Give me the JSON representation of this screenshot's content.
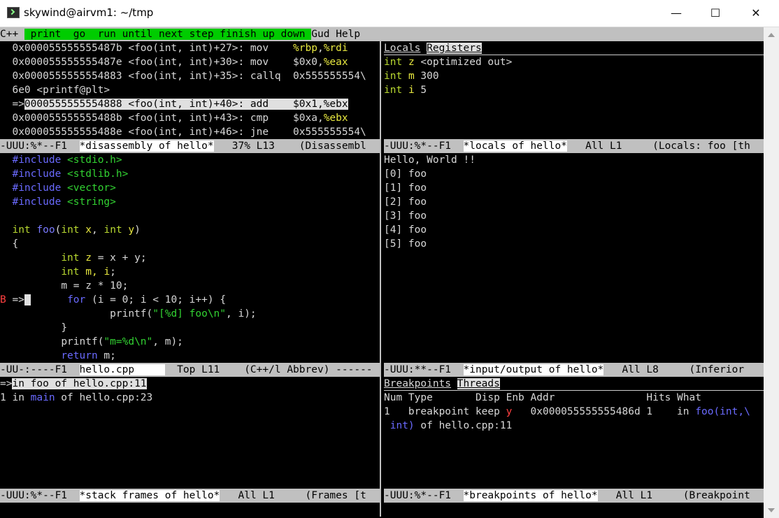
{
  "window": {
    "title": "skywind@airvm1: ~/tmp",
    "min_glyph": "—",
    "max_glyph": "☐",
    "close_glyph": "✕"
  },
  "menubar": {
    "lang": "C++",
    "green_items": " print  go  run until next step finish up down ",
    "gud": "Gud",
    "help": "Help"
  },
  "disasm": {
    "lines": [
      [
        "  0x000055555555487b <foo(int, int)+27>: mov    ",
        "%rbp",
        ",",
        "%rdi"
      ],
      [
        "  0x000055555555487e <foo(int, int)+30>: mov    $0x0,",
        "%eax",
        "",
        ""
      ],
      [
        "  0x0000555555554883 <foo(int, int)+35>: callq  0x555555554\\",
        "",
        "",
        ""
      ],
      [
        "  6e0 <printf@plt>",
        "",
        "",
        ""
      ],
      [
        "  =>",
        "0000555555554888 <foo(int, int)+40>: add    $0x1,%ebx",
        "",
        ""
      ],
      [
        "  0x000055555555488b <foo(int, int)+43>: cmp    $0xa,",
        "%ebx",
        "",
        ""
      ],
      [
        "  0x000055555555488e <foo(int, int)+46>: jne    0x555555554\\",
        "",
        "",
        ""
      ]
    ],
    "modeline_pre": "-UUU:%*--F1  ",
    "modeline_name": "*disassembly of hello*",
    "modeline_post": "   37% L13    (Disassembl"
  },
  "locals": {
    "tab1": "Locals",
    "tab2": "Registers",
    "vars": [
      {
        "type": "int",
        "name": "z",
        "value": "<optimized out>"
      },
      {
        "type": "int",
        "name": "m",
        "value": "300"
      },
      {
        "type": "int",
        "name": "i",
        "value": "5"
      }
    ],
    "modeline_pre": "-UUU:%*--F1  ",
    "modeline_name": "*locals of hello*",
    "modeline_post": "   All L1     (Locals: foo [th"
  },
  "source": {
    "includes": [
      [
        "#include",
        "<stdio.h>"
      ],
      [
        "#include",
        "<stdlib.h>"
      ],
      [
        "#include",
        "<vector>"
      ],
      [
        "#include",
        "<string>"
      ]
    ],
    "sig_int": "int",
    "sig_fn": "foo",
    "sig_p1t": "int",
    "sig_p1": "x",
    "sig_p2t": "int",
    "sig_p2": "y",
    "open": "{",
    "l_z_t": "int",
    "l_z": "z",
    "l_z_rest": " = x + y;",
    "l_m_t": "int",
    "l_m": "m, i",
    "l_m_rest": ";",
    "l_assign": "m = z * 10;",
    "bp_mark": "B",
    "arrow": " =>",
    "l_for_kw": "for",
    "l_for_rest": " (i = 0; i < 10; i++) {",
    "l_printf1_a": "printf(",
    "l_printf1_s": "\"[%d] foo\\n\"",
    "l_printf1_b": ", i);",
    "close_inner": "}",
    "l_printf2_a": "printf(",
    "l_printf2_s": "\"m=%d\\n\"",
    "l_printf2_b": ", m);",
    "l_return_kw": "return",
    "l_return_rest": " m;",
    "modeline_pre": "-UU-:----F1  ",
    "modeline_name": "hello.cpp     ",
    "modeline_post": "  Top L11    (C++/l Abbrev) ------"
  },
  "io": {
    "lines": [
      "Hello, World !!",
      "[0] foo",
      "[1] foo",
      "[2] foo",
      "[3] foo",
      "[4] foo",
      "[5] foo"
    ],
    "modeline_pre": "-UUU:**--F1  ",
    "modeline_name": "*input/output of hello*",
    "modeline_post": "   All L8     (Inferior"
  },
  "frames": {
    "f0_arrow": "=>",
    "f0_text": "in foo of hello.cpp:11",
    "f1_num": "1 in ",
    "f1_fn": "main",
    "f1_rest": " of hello.cpp:23",
    "modeline_pre": "-UUU:%*--F1  ",
    "modeline_name": "*stack frames of hello*",
    "modeline_post": "   All L1     (Frames [t"
  },
  "breakpoints": {
    "tab1": "Breakpoints",
    "tab2": "Threads",
    "header": "Num Type       Disp Enb Addr               Hits What",
    "r1_a": "1   breakpoint keep ",
    "r1_enb": "y",
    "r1_b": "   0x000055555555486d 1    in ",
    "r1_fn": "foo(int,\\",
    "r2_fn": " int)",
    "r2_rest": " of hello.cpp:11",
    "modeline_pre": "-UUU:%*--F1  ",
    "modeline_name": "*breakpoints of hello*",
    "modeline_post": "   All L1     (Breakpoint"
  }
}
